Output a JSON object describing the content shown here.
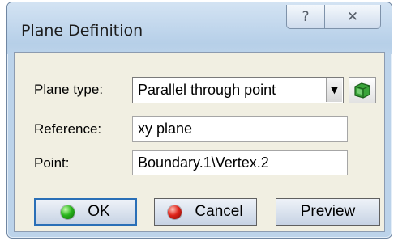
{
  "window": {
    "title": "Plane Definition",
    "help_glyph": "?",
    "close_glyph": "✕"
  },
  "form": {
    "plane_type": {
      "label": "Plane type:",
      "value": "Parallel through point",
      "arrow": "▼"
    },
    "reference": {
      "label": "Reference:",
      "value": "xy plane"
    },
    "point": {
      "label": "Point:",
      "value": "Boundary.1\\Vertex.2"
    }
  },
  "buttons": {
    "ok": "OK",
    "cancel": "Cancel",
    "preview": "Preview"
  },
  "icons": {
    "plane_type_action": "green-cube-icon",
    "ok": "green-dot-icon",
    "cancel": "red-dot-icon"
  },
  "colors": {
    "frame": "#bcd3ea",
    "dialog_bg": "#f1efe2",
    "ok_border": "#2a6fb7"
  }
}
